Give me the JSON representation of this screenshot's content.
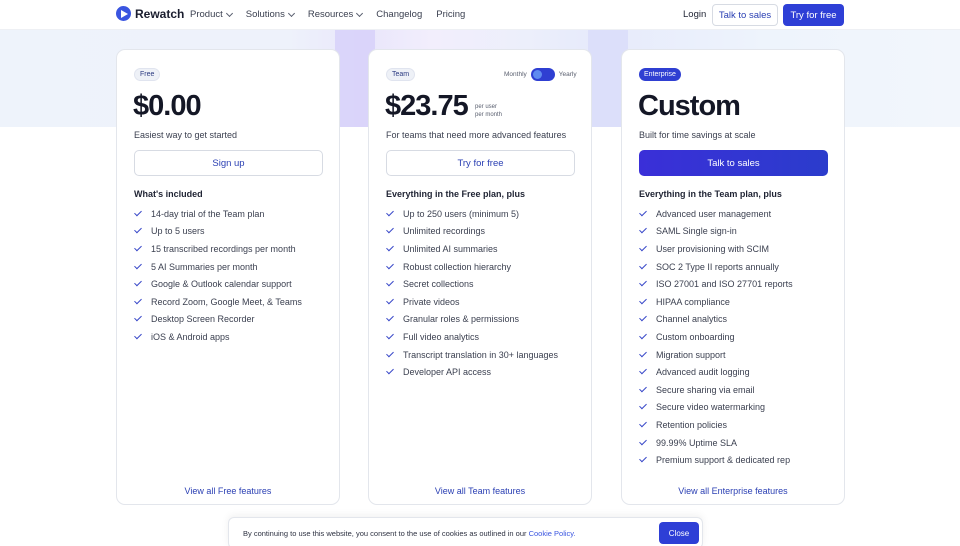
{
  "nav": {
    "logo_text": "Rewatch",
    "links": [
      "Product",
      "Solutions",
      "Resources",
      "Changelog",
      "Pricing"
    ],
    "login": "Login",
    "talk_to_sales": "Talk to sales",
    "try_free": "Try for free"
  },
  "plans": {
    "free": {
      "badge": "Free",
      "price": "$0.00",
      "tagline": "Easiest way to get started",
      "cta": "Sign up",
      "features_heading": "What's included",
      "features": [
        "14-day trial of the Team plan",
        "Up to 5 users",
        "15 transcribed recordings per month",
        "5 AI Summaries per month",
        "Google & Outlook calendar support",
        "Record Zoom, Google Meet, & Teams",
        "Desktop Screen Recorder",
        "iOS & Android apps"
      ],
      "view_all": "View all Free features"
    },
    "team": {
      "badge": "Team",
      "toggle_left": "Monthly",
      "toggle_right": "Yearly",
      "price": "$23.75",
      "price_sub_1": "per user",
      "price_sub_2": "per month",
      "tagline": "For teams that need more advanced features",
      "cta": "Try for free",
      "features_heading": "Everything in the Free plan, plus",
      "features": [
        "Up to 250 users (minimum 5)",
        "Unlimited recordings",
        "Unlimited AI summaries",
        "Robust collection hierarchy",
        "Secret collections",
        "Private videos",
        "Granular roles & permissions",
        "Full video analytics",
        "Transcript translation in 30+ languages",
        "Developer API access"
      ],
      "view_all": "View all Team features"
    },
    "enterprise": {
      "badge": "Enterprise",
      "price": "Custom",
      "tagline": "Built for time savings at scale",
      "cta": "Talk to sales",
      "features_heading": "Everything in the Team plan, plus",
      "features": [
        "Advanced user management",
        "SAML Single sign-in",
        "User provisioning with SCIM",
        "SOC 2 Type II reports annually",
        "ISO 27001 and ISO 27701 reports",
        "HIPAA compliance",
        "Channel analytics",
        "Custom onboarding",
        "Migration support",
        "Advanced audit logging",
        "Secure sharing via email",
        "Secure video watermarking",
        "Retention policies",
        "99.99% Uptime SLA",
        "Premium support & dedicated rep"
      ],
      "view_all": "View all Enterprise features"
    }
  },
  "cookie": {
    "text": "By continuing to use this website, you consent to the use of cookies as outlined in our ",
    "link": "Cookie Policy.",
    "close": "Close"
  }
}
